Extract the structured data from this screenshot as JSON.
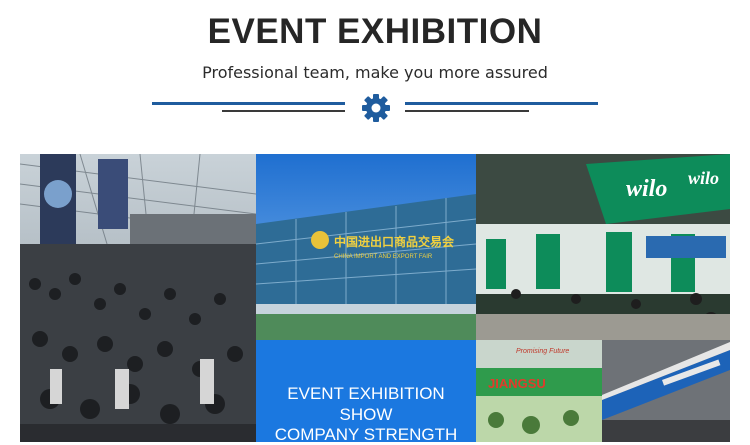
{
  "header": {
    "title": "EVENT EXHIBITION",
    "subtitle": "Professional team, make you more assured",
    "accent_color": "#1f5c9e",
    "icon": "gear-icon"
  },
  "gallery": {
    "photos": [
      {
        "name": "crowded-trade-fair-hall-photo"
      },
      {
        "name": "canton-fair-building-photo",
        "sign_text": "中国进出口商品交易会",
        "sign_text_en": "CHINA IMPORT AND EXPORT FAIR"
      },
      {
        "name": "wilo-booth-photo",
        "brand": "wilo"
      },
      {
        "name": "jiangsu-booth-photo",
        "sign_text": "JIANGSU",
        "sub_text": "Promising Future"
      },
      {
        "name": "exhibition-hall-banner-photo"
      }
    ],
    "blue_card": {
      "line1": "EVENT EXHIBITION",
      "line2": "SHOW",
      "line3": "COMPANY STRENGTH",
      "color": "#1b78e0"
    }
  }
}
